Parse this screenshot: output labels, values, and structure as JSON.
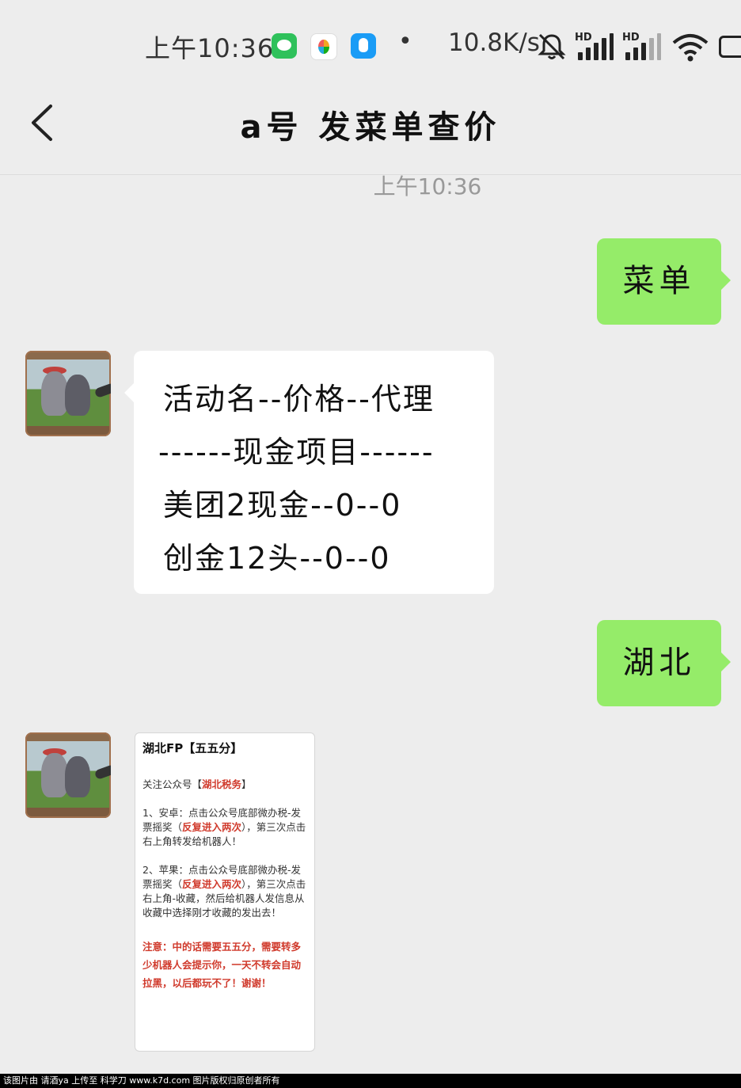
{
  "status_bar": {
    "time": "上午10:36",
    "app_icons": [
      "wechat-icon",
      "video-app-icon",
      "qq-icon"
    ],
    "dot": "•",
    "net_speed": "10.8K/s",
    "signal_label_1": "HD",
    "signal_label_2": "HD"
  },
  "header": {
    "title": "a号 发菜单查价"
  },
  "timestamp": "上午10:36",
  "messages": {
    "m1": {
      "text": "菜单"
    },
    "m2": {
      "lines": [
        "活动名--价格--代理",
        "------现金项目------",
        "美团2现金--0--0",
        "创金12头--0--0"
      ]
    },
    "m3": {
      "text": "湖北"
    },
    "m4": {
      "title": "湖北FP【五五分】",
      "follow_prefix": "关注公众号【",
      "follow_account": "湖北税务",
      "follow_suffix": "】",
      "android_a": "1、安卓：点击公众号底部微办税-发票摇奖（",
      "android_red": "反复进入两次",
      "android_b": "），第三次点击右上角转发给机器人！",
      "apple_a": "2、苹果：点击公众号底部微办税-发票摇奖（",
      "apple_red": "反复进入两次",
      "apple_b": "），第三次点击右上角-收藏，然后给机器人发信息从收藏中选择刚才收藏的发出去！",
      "note": "注意：中的话需要五五分，需要转多少机器人会提示你，一天不转会自动拉黑，以后都玩不了！谢谢！"
    }
  },
  "footer": "该图片由 请酒ya 上传至 科学刀 www.k7d.com 图片版权归原创者所有",
  "colors": {
    "background": "#ededed",
    "outgoing_bubble": "#95ec69",
    "incoming_bubble": "#ffffff",
    "highlight_red": "#d03a2c"
  }
}
